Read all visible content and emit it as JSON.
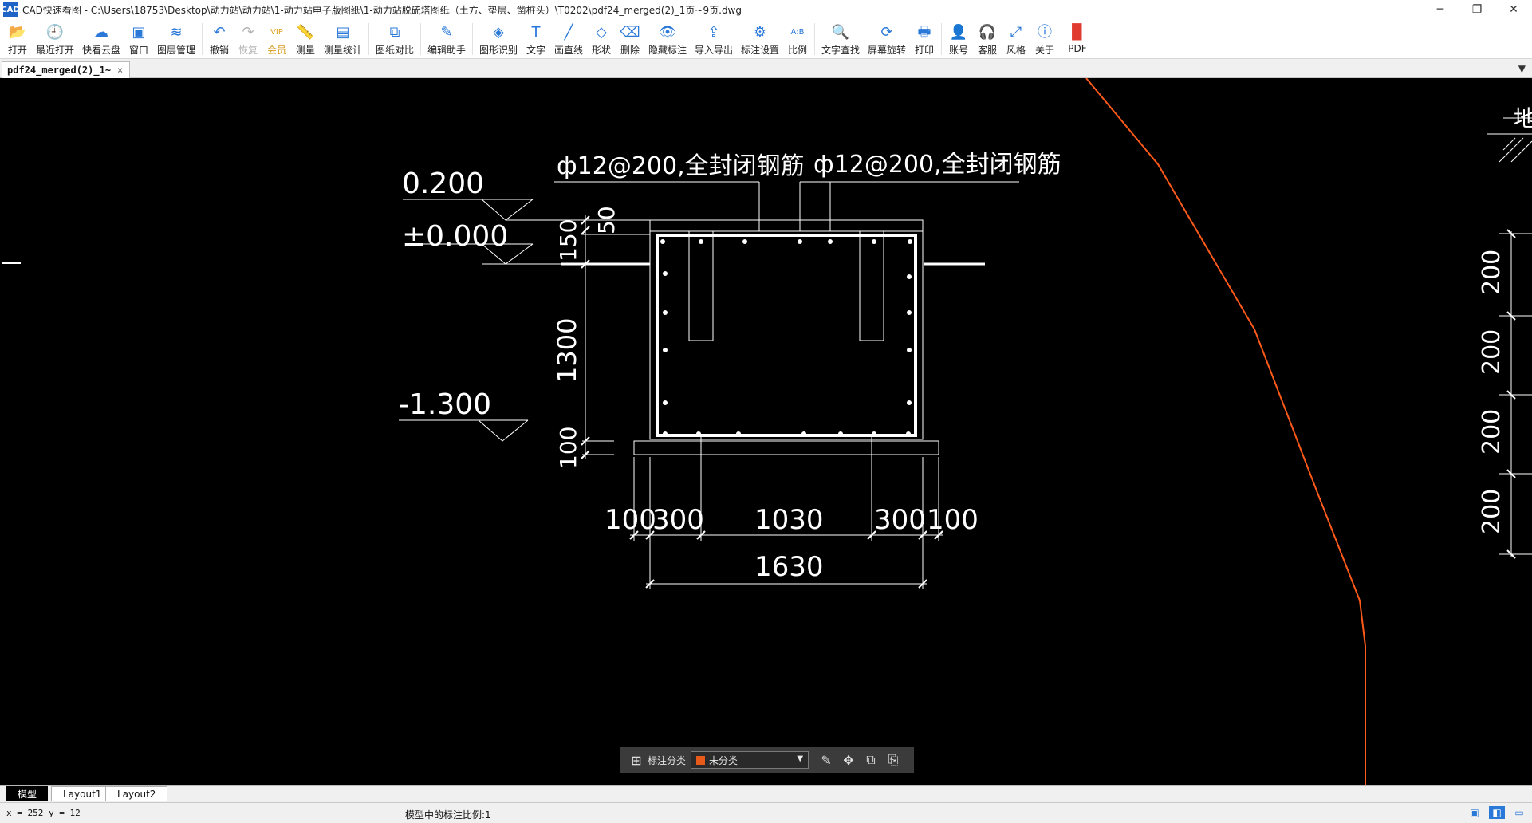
{
  "window": {
    "app_icon_text": "CAD",
    "title": "CAD快速看图 - C:\\Users\\18753\\Desktop\\动力站\\动力站\\1-动力站电子版图纸\\1-动力站脱硫塔图纸（土方、垫层、凿桩头）\\T0202\\pdf24_merged(2)_1页~9页.dwg",
    "minimize": "─",
    "maximize": "❐",
    "close": "✕"
  },
  "toolbar": [
    {
      "name": "open",
      "label": "打开",
      "icon": "📂"
    },
    {
      "name": "recent",
      "label": "最近打开",
      "icon": "🕘"
    },
    {
      "name": "cloud",
      "label": "快看云盘",
      "icon": "☁"
    },
    {
      "name": "window",
      "label": "窗口",
      "icon": "▣"
    },
    {
      "name": "layers",
      "label": "图层管理",
      "icon": "≋"
    },
    {
      "sep": true
    },
    {
      "name": "undo",
      "label": "撤销",
      "icon": "↶"
    },
    {
      "name": "redo",
      "label": "恢复",
      "icon": "↷",
      "disabled": true
    },
    {
      "name": "vip",
      "label": "会员",
      "icon": "VIP",
      "vip": true
    },
    {
      "name": "measure",
      "label": "测量",
      "icon": "📏"
    },
    {
      "name": "measure-stats",
      "label": "测量统计",
      "icon": "▤"
    },
    {
      "sep": true
    },
    {
      "name": "compare",
      "label": "图纸对比",
      "icon": "⧉"
    },
    {
      "sep": true
    },
    {
      "name": "edit-assistant",
      "label": "编辑助手",
      "icon": "✎"
    },
    {
      "sep": true
    },
    {
      "name": "shape-recognition",
      "label": "图形识别",
      "icon": "◈"
    },
    {
      "name": "text",
      "label": "文字",
      "icon": "T"
    },
    {
      "name": "draw-line",
      "label": "画直线",
      "icon": "╱"
    },
    {
      "name": "shape",
      "label": "形状",
      "icon": "◇"
    },
    {
      "name": "delete",
      "label": "删除",
      "icon": "⌫"
    },
    {
      "name": "hide-annotations",
      "label": "隐藏标注",
      "icon": "👁"
    },
    {
      "name": "import-export",
      "label": "导入导出",
      "icon": "⇪"
    },
    {
      "name": "annotation-settings",
      "label": "标注设置",
      "icon": "⚙"
    },
    {
      "name": "scale",
      "label": "比例",
      "icon": "A:B"
    },
    {
      "sep": true
    },
    {
      "name": "find-text",
      "label": "文字查找",
      "icon": "🔍"
    },
    {
      "name": "rotate-screen",
      "label": "屏幕旋转",
      "icon": "⟳"
    },
    {
      "name": "print",
      "label": "打印",
      "icon": "🖶"
    },
    {
      "sep": true
    },
    {
      "name": "account",
      "label": "账号",
      "icon": "👤"
    },
    {
      "name": "support",
      "label": "客服",
      "icon": "🎧"
    },
    {
      "name": "style",
      "label": "风格",
      "icon": "⤢"
    },
    {
      "name": "about",
      "label": "关于",
      "icon": "ⓘ"
    },
    {
      "name": "pdf",
      "label": "PDF",
      "icon": "▉",
      "pdf": true
    }
  ],
  "doc_tab": {
    "label": "pdf24_merged(2)_1~",
    "close": "×",
    "menu_arrow": "▼"
  },
  "drawing": {
    "texts": {
      "rebar_left": "ф12@200,全封闭钢筋",
      "rebar_right": "ф12@200,全封闭钢筋",
      "elev_top": "0.200",
      "elev_zero": "±0.000",
      "elev_bottom": "-1.300",
      "dim_50": "50",
      "dim_150": "150",
      "dim_1300": "1300",
      "dim_100_v": "100",
      "dim_100_l": "100",
      "dim_300_l": "300",
      "dim_1030": "1030",
      "dim_300_r": "300",
      "dim_100_r": "100",
      "dim_1630": "1630",
      "right_200_1": "200",
      "right_200_2": "200",
      "right_200_3": "200",
      "right_200_4": "200",
      "right_partial": "地"
    },
    "colors": {
      "background": "#000000",
      "lines": "#ffffff",
      "curve": "#ff5a1a"
    }
  },
  "annotation_toolbar": {
    "category_label": "标注分类",
    "category_value": "未分类",
    "swatch_color": "#e85a1a",
    "dropdown_arrow": "▼"
  },
  "layout_tabs": {
    "model": "模型",
    "layout1": "Layout1",
    "layout2": "Layout2"
  },
  "status": {
    "coords": "x = 252  y = 12",
    "scale_message": "模型中的标注比例:1"
  }
}
